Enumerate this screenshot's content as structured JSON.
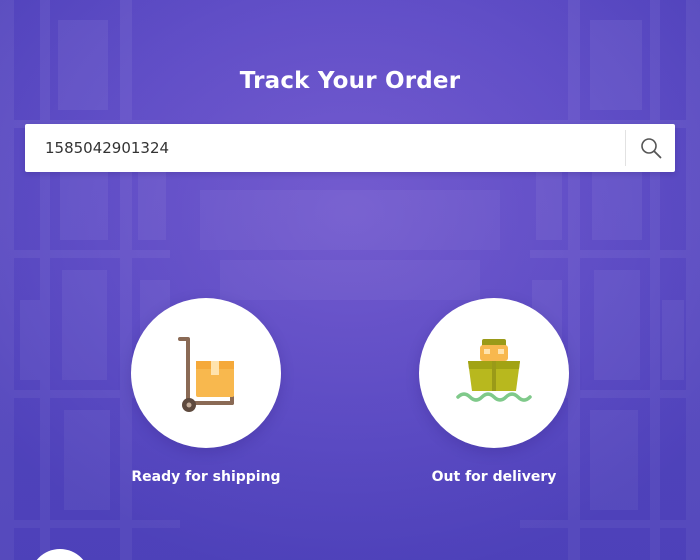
{
  "page": {
    "title": "Track Your Order"
  },
  "search": {
    "value": "1585042901324",
    "placeholder": "",
    "button_icon": "search-icon"
  },
  "steps": [
    {
      "label": "Ready for shipping",
      "icon": "hand-truck-box-icon"
    },
    {
      "label": "Out for delivery",
      "icon": "cargo-ship-icon"
    }
  ],
  "colors": {
    "overlay": "#5b4cc4",
    "overlay_light": "#7a63d6",
    "text": "#ffffff",
    "box": "#f8b84e",
    "truck": "#8a6a55",
    "ship_hull": "#b8b81e",
    "waves": "#7fc98a"
  }
}
